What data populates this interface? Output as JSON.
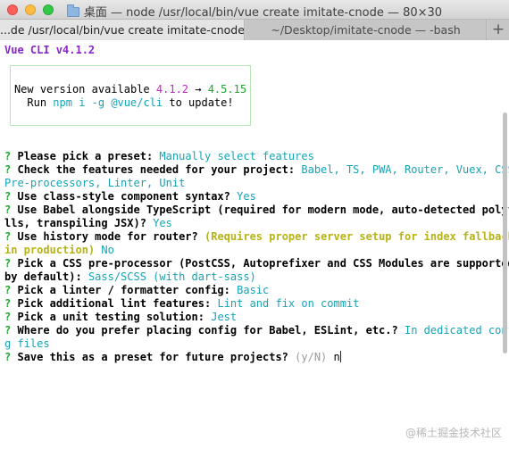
{
  "window": {
    "title": "桌面 — node /usr/local/bin/vue create imitate-cnode — 80×30"
  },
  "tabs": [
    {
      "label": "...de /usr/local/bin/vue create imitate-cnode"
    },
    {
      "label": "~/Desktop/imitate-cnode — -bash"
    }
  ],
  "tab_add_label": "+",
  "terminal": {
    "version_line": "Vue CLI v4.1.2",
    "update_box": {
      "line1_prefix": "New version available ",
      "current_version": "4.1.2",
      "arrow": " → ",
      "new_version": "4.5.15",
      "line2_prefix": "Run ",
      "command": "npm i -g @vue/cli",
      "line2_suffix": " to update!"
    },
    "prompts": [
      {
        "mark": "?",
        "question": "Please pick a preset:",
        "answer": "Manually select features"
      },
      {
        "mark": "?",
        "question": "Check the features needed for your project:",
        "answer": "Babel, TS, PWA, Router, Vuex, CSS"
      },
      {
        "continuation": "Pre-processors, Linter, Unit"
      },
      {
        "mark": "?",
        "question": "Use class-style component syntax?",
        "answer": "Yes"
      },
      {
        "mark": "?",
        "question": "Use Babel alongside TypeScript (required for modern mode, auto-detected polyfi"
      },
      {
        "continuation_bold": "lls, transpiling JSX)?",
        "answer": "Yes"
      },
      {
        "mark": "?",
        "question": "Use history mode for router?",
        "note": "(Requires proper server setup for index fallback"
      },
      {
        "note_cont": "in production)",
        "answer": "No"
      },
      {
        "mark": "?",
        "question": "Pick a CSS pre-processor (PostCSS, Autoprefixer and CSS Modules are supported"
      },
      {
        "continuation_bold": "by default):",
        "answer": "Sass/SCSS (with dart-sass)"
      },
      {
        "mark": "?",
        "question": "Pick a linter / formatter config:",
        "answer": "Basic"
      },
      {
        "mark": "?",
        "question": "Pick additional lint features:",
        "answer": "Lint and fix on commit"
      },
      {
        "mark": "?",
        "question": "Pick a unit testing solution:",
        "answer": "Jest"
      },
      {
        "mark": "?",
        "question": "Where do you prefer placing config for Babel, ESLint, etc.?",
        "answer": "In dedicated confi"
      },
      {
        "continuation_answer": "g files"
      },
      {
        "mark": "?",
        "question": "Save this as a preset for future projects?",
        "hint": "(y/N)",
        "input": "n"
      }
    ]
  },
  "watermark": "@稀土掘金技术社区",
  "colors": {
    "prompt_mark": "#21a531",
    "answer": "#16a3b5",
    "version": "#8a25c9",
    "note": "#b7b316"
  }
}
